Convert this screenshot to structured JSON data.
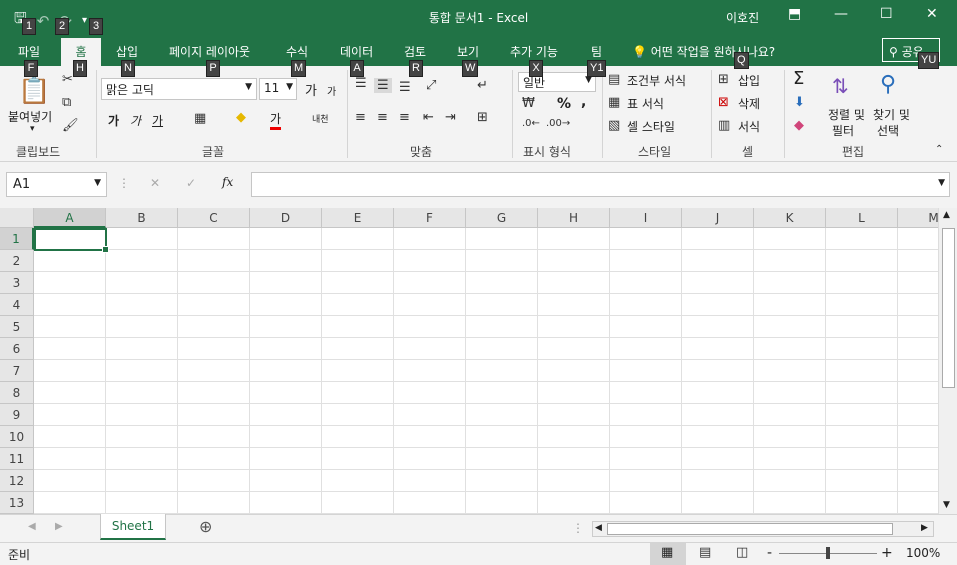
{
  "window": {
    "title": "통합 문서1 - Excel",
    "user": "이호진",
    "minimize": "—",
    "maximize": "☐",
    "close": "✕",
    "ribbon_display": "⬒"
  },
  "qat": {
    "save": "🖫",
    "undo": "↶",
    "redo": "↷",
    "customize": "▾"
  },
  "tabs": [
    {
      "label": "파일",
      "key": "F"
    },
    {
      "label": "홈",
      "key": "H"
    },
    {
      "label": "삽입",
      "key": "N"
    },
    {
      "label": "페이지 레이아웃",
      "key": "P"
    },
    {
      "label": "수식",
      "key": "M"
    },
    {
      "label": "데이터",
      "key": "A"
    },
    {
      "label": "검토",
      "key": "R"
    },
    {
      "label": "보기",
      "key": "W"
    },
    {
      "label": "추가 기능",
      "key": "X"
    },
    {
      "label": "팀",
      "key": "Y1"
    }
  ],
  "tellme": "어떤 작업을 원하시나요?",
  "tellme_key": "Q",
  "share": {
    "label": "공유",
    "key": "YU"
  },
  "qat_keys": [
    "1",
    "2",
    "3"
  ],
  "ribbon": {
    "clipboard": {
      "label": "클립보드",
      "paste": "붙여넣기"
    },
    "font": {
      "label": "글꼴",
      "name": "맑은 고딕",
      "size": "11",
      "bold": "가",
      "italic": "가",
      "underline": "가",
      "grow": "가",
      "shrink": "가",
      "color": "가",
      "phonetic": "내천"
    },
    "alignment": {
      "label": "맞춤"
    },
    "number": {
      "label": "표시 형식",
      "format": "일반",
      "percent": "%",
      "comma": ","
    },
    "styles": {
      "label": "스타일",
      "conditional": "조건부 서식",
      "table": "표 서식",
      "cell": "셀 스타일"
    },
    "cells": {
      "label": "셀",
      "insert": "삽입",
      "delete": "삭제",
      "format": "서식"
    },
    "editing": {
      "label": "편집",
      "sort1": "정렬 및",
      "sort2": "필터",
      "find1": "찾기 및",
      "find2": "선택",
      "sigma": "Σ"
    }
  },
  "formula_bar": {
    "name_box": "A1",
    "cancel": "✕",
    "enter": "✓",
    "fx": "fx",
    "value": ""
  },
  "columns": [
    "A",
    "B",
    "C",
    "D",
    "E",
    "F",
    "G",
    "H",
    "I",
    "J",
    "K",
    "L",
    "M"
  ],
  "rows": [
    "1",
    "2",
    "3",
    "4",
    "5",
    "6",
    "7",
    "8",
    "9",
    "10",
    "11",
    "12",
    "13"
  ],
  "active_cell": "A1",
  "sheets": [
    {
      "label": "Sheet1"
    }
  ],
  "add_sheet": "⊕",
  "status": {
    "ready": "준비",
    "zoom": "100%",
    "minus": "-",
    "plus": "+"
  }
}
